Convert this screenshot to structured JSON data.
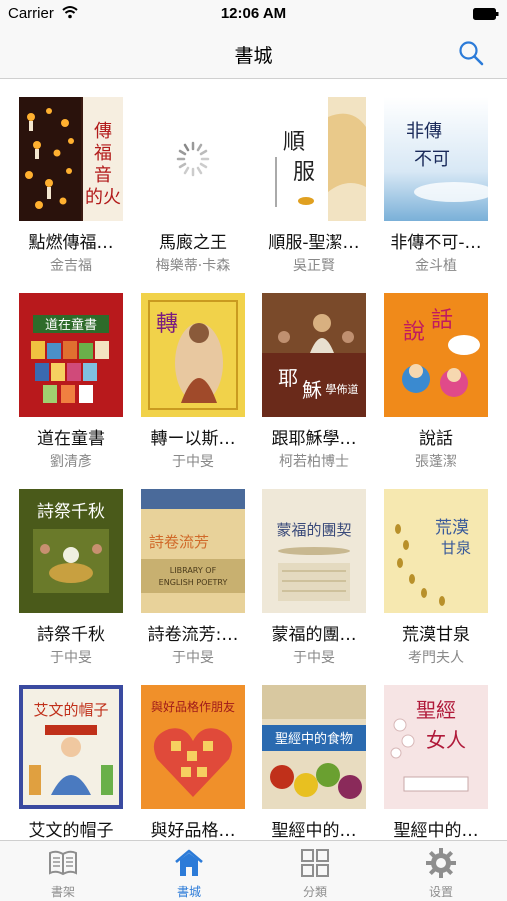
{
  "status_bar": {
    "carrier": "Carrier",
    "time": "12:06 AM"
  },
  "nav": {
    "title": "書城"
  },
  "books": [
    {
      "title": "點燃傳福…",
      "author": "金吉福",
      "cover": "candles",
      "cover_text": "點燃傳福音的火"
    },
    {
      "title": "馬廄之王",
      "author": "梅樂蒂·卡森",
      "cover": "loading",
      "cover_text": ""
    },
    {
      "title": "順服-聖潔…",
      "author": "吳正賢",
      "cover": "obedience",
      "cover_text": "順服"
    },
    {
      "title": "非傳不可-…",
      "author": "金斗植",
      "cover": "sky",
      "cover_text": "非傳不可"
    },
    {
      "title": "道在童書",
      "author": "劉清彥",
      "cover": "redbooks",
      "cover_text": "道在童書"
    },
    {
      "title": "轉ー以斯…",
      "author": "于中旻",
      "cover": "esther",
      "cover_text": "轉"
    },
    {
      "title": "跟耶穌學…",
      "author": "柯若柏博士",
      "cover": "jesus",
      "cover_text": "跟耶穌學佈道"
    },
    {
      "title": "說話",
      "author": "張蓬潔",
      "cover": "talk",
      "cover_text": "說話"
    },
    {
      "title": "詩祭千秋",
      "author": "于中旻",
      "cover": "lamb",
      "cover_text": "詩祭千秋"
    },
    {
      "title": "詩卷流芳:…",
      "author": "于中旻",
      "cover": "poetry",
      "cover_text": "詩卷流芳"
    },
    {
      "title": "蒙福的團…",
      "author": "于中旻",
      "cover": "fellowship",
      "cover_text": "蒙福的團契"
    },
    {
      "title": "荒漠甘泉",
      "author": "考門夫人",
      "cover": "desert",
      "cover_text": "荒漠甘泉"
    },
    {
      "title": "艾文的帽子",
      "author": "",
      "cover": "hat",
      "cover_text": "艾文的帽子"
    },
    {
      "title": "與好品格…",
      "author": "",
      "cover": "character",
      "cover_text": "與好品格作朋友"
    },
    {
      "title": "聖經中的…",
      "author": "",
      "cover": "food",
      "cover_text": "聖經中的食物"
    },
    {
      "title": "聖經中的…",
      "author": "",
      "cover": "women",
      "cover_text": "聖經中的女人"
    }
  ],
  "tabs": [
    {
      "label": "書架",
      "icon": "book-icon",
      "active": false
    },
    {
      "label": "書城",
      "icon": "home-icon",
      "active": true
    },
    {
      "label": "分類",
      "icon": "grid-icon",
      "active": false
    },
    {
      "label": "设置",
      "icon": "gear-icon",
      "active": false
    }
  ],
  "colors": {
    "accent": "#2c7bd8",
    "inactive": "#8e8e8e",
    "bar": "#f8f8f8"
  }
}
